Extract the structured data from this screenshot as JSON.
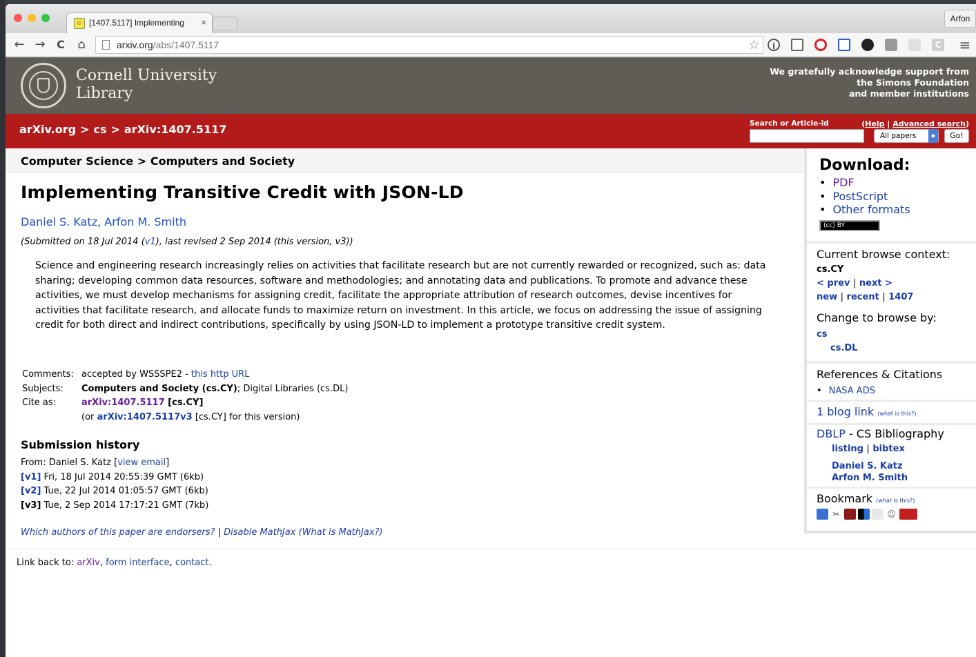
{
  "browser": {
    "tab_title": "[1407.5117] Implementing",
    "tab_close": "×",
    "profile": "Arfon",
    "url_host": "arxiv.org",
    "url_path": "/abs/1407.5117",
    "nav": {
      "back": "←",
      "forward": "→",
      "reload": "C",
      "home": "⌂"
    },
    "star": "☆"
  },
  "cornell": {
    "name_line1": "Cornell University",
    "name_line2": "Library",
    "ack_line1": "We gratefully acknowledge support from",
    "ack_line2": "the Simons Foundation",
    "ack_line3": "and member institutions"
  },
  "header": {
    "crumbs": [
      "arXiv.org",
      ">",
      "cs",
      ">",
      "arXiv:1407.5117"
    ],
    "search_label": "Search or Article-id",
    "help": "Help",
    "help_sep": "|",
    "advanced": "Advanced search",
    "select_value": "All papers",
    "go": "Go!"
  },
  "paper": {
    "subject_path": "Computer Science > Computers and Society",
    "title": "Implementing Transitive Credit with JSON-LD",
    "author1": "Daniel S. Katz",
    "author2": "Arfon M. Smith",
    "submitted_pre": "(Submitted on 18 Jul 2014 (",
    "submitted_v1": "v1",
    "submitted_post": "), last revised 2 Sep 2014 (this version, v3))",
    "abstract": "Science and engineering research increasingly relies on activities that facilitate research but are not currently rewarded or recognized, such as: data sharing; developing common data resources, software and methodologies; and annotating data and publications. To promote and advance these activities, we must develop mechanisms for assigning credit, facilitate the appropriate attribution of research outcomes, devise incentives for activities that facilitate research, and allocate funds to maximize return on investment. In this article, we focus on addressing the issue of assigning credit for both direct and indirect contributions, specifically by using JSON-LD to implement a prototype transitive credit system."
  },
  "meta": {
    "comments_label": "Comments:",
    "comments_text": "accepted by WSSSPE2 - ",
    "comments_link": "this http URL",
    "subjects_label": "Subjects:",
    "subjects_primary": "Computers and Society (cs.CY)",
    "subjects_rest": "; Digital Libraries (cs.DL)",
    "cite_label": "Cite as:",
    "cite_id": "arXiv:1407.5117",
    "cite_cat": " [cs.CY]",
    "cite2_pre": "(or ",
    "cite2_id": "arXiv:1407.5117v3",
    "cite2_post": " [cs.CY] for this version)"
  },
  "history": {
    "heading": "Submission history",
    "from_pre": "From: Daniel S. Katz [",
    "from_link": "view email",
    "from_post": "]",
    "versions": [
      {
        "tag": "[v1]",
        "text": " Fri, 18 Jul 2014 20:55:39 GMT (6kb)"
      },
      {
        "tag": "[v2]",
        "text": " Tue, 22 Jul 2014 01:05:57 GMT (6kb)"
      },
      {
        "tag": "[v3]",
        "text": " Tue, 2 Sep 2014 17:17:21 GMT (7kb)"
      }
    ],
    "endorsers": "Which authors of this paper are endorsers?",
    "sep": " | ",
    "disable_mathjax": "Disable MathJax",
    "what_mathjax": " (What is MathJax?)"
  },
  "footer": {
    "label": "Link back to: ",
    "arxiv": "arXiv",
    "form": "form interface",
    "contact": "contact",
    "comma": ", ",
    "period": "."
  },
  "sidebar": {
    "download": "Download:",
    "formats": [
      "PDF",
      "PostScript",
      "Other formats"
    ],
    "license": "(cc) BY",
    "context_label": "Current browse context:",
    "context_value": "cs.CY",
    "prev": "< prev",
    "next": "next >",
    "pipe": "|",
    "new": "new",
    "recent": "recent",
    "month": "1407",
    "change_label": "Change to browse by:",
    "browse1": "cs",
    "browse2": "cs.DL",
    "refs_label": "References & Citations",
    "nasa": "NASA ADS",
    "blog": "1 blog link",
    "blog_what": "(what is this?)",
    "dblp": "DBLP",
    "dblp_rest": " - CS Bibliography",
    "listing": "listing",
    "bibtex": "bibtex",
    "dblp_author1": "Daniel S. Katz",
    "dblp_author2": "Arfon M. Smith",
    "bookmark": "Bookmark",
    "bookmark_what": "(what is this?)"
  }
}
